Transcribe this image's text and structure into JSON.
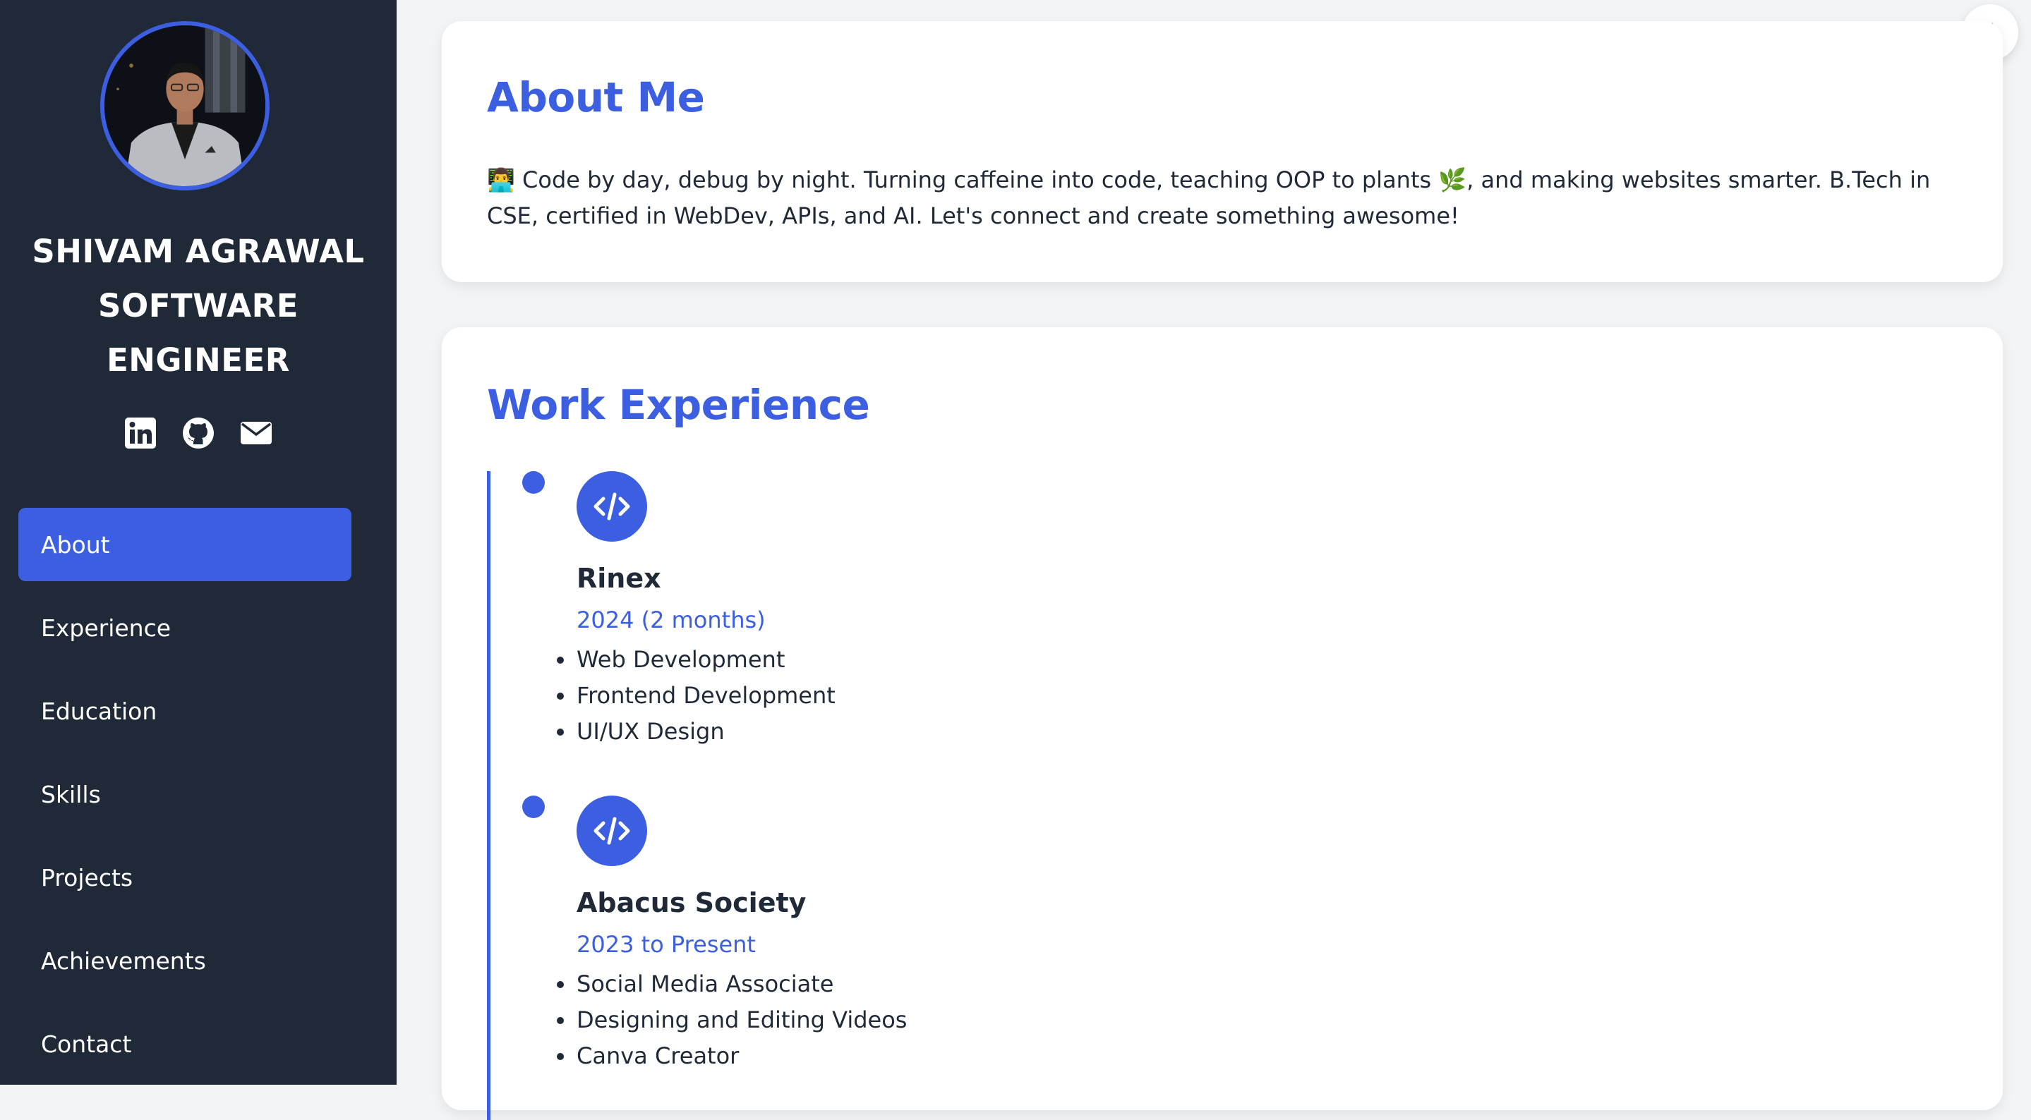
{
  "sidebar": {
    "avatar_alt": "profile photo",
    "name_lines": [
      "SHIVAM AGRAWAL",
      "SOFTWARE",
      "ENGINEER"
    ],
    "socials": [
      {
        "icon": "linkedin-icon"
      },
      {
        "icon": "github-icon"
      },
      {
        "icon": "envelope-icon"
      }
    ],
    "nav": [
      {
        "label": "About",
        "active": true
      },
      {
        "label": "Experience",
        "active": false
      },
      {
        "label": "Education",
        "active": false
      },
      {
        "label": "Skills",
        "active": false
      },
      {
        "label": "Projects",
        "active": false
      },
      {
        "label": "Achievements",
        "active": false
      },
      {
        "label": "Contact",
        "active": false
      }
    ]
  },
  "theme_toggle": {
    "icon": "moon-icon"
  },
  "about": {
    "title": "About Me",
    "text": "👨‍💻 Code by day, debug by night. Turning caffeine into code, teaching OOP to plants 🌿, and making websites smarter. B.Tech in CSE, certified in WebDev, APIs, and AI. Let's connect and create something awesome!"
  },
  "work": {
    "title": "Work Experience",
    "entries": [
      {
        "icon": "code-icon",
        "company": "Rinex",
        "period": "2024 (2 months)",
        "items": [
          "Web Development",
          "Frontend Development",
          "UI/UX Design"
        ]
      },
      {
        "icon": "code-icon",
        "company": "Abacus Society",
        "period": "2023 to Present",
        "items": [
          "Social Media Associate",
          "Designing and Editing Videos",
          "Canva Creator"
        ]
      }
    ]
  },
  "colors": {
    "accent": "#3b5fe0",
    "sidebar_bg": "#1f2937",
    "page_bg": "#f3f4f6",
    "card_bg": "#ffffff",
    "text": "#1f2937"
  }
}
